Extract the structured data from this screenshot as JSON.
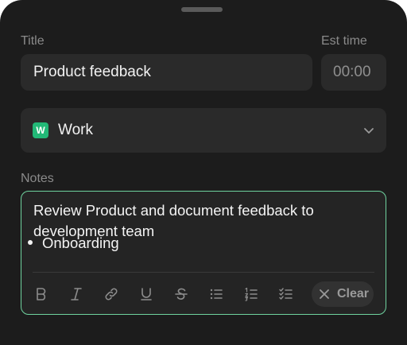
{
  "form": {
    "title_label": "Title",
    "title_value": "Product feedback",
    "est_time_label": "Est time",
    "est_time_value": "00:00",
    "category": {
      "badge_letter": "W",
      "name": "Work",
      "badge_color": "#22b877"
    },
    "notes_label": "Notes",
    "notes": {
      "text": "Review Product and document feedback to development team",
      "bullets": [
        "Onboarding"
      ],
      "border_color": "#6fd39f"
    },
    "toolbar": {
      "icons": [
        "bold-icon",
        "italic-icon",
        "link-icon",
        "underline-icon",
        "strikethrough-icon",
        "bullet-list-icon",
        "numbered-list-icon",
        "checklist-icon"
      ],
      "clear_label": "Clear"
    }
  }
}
